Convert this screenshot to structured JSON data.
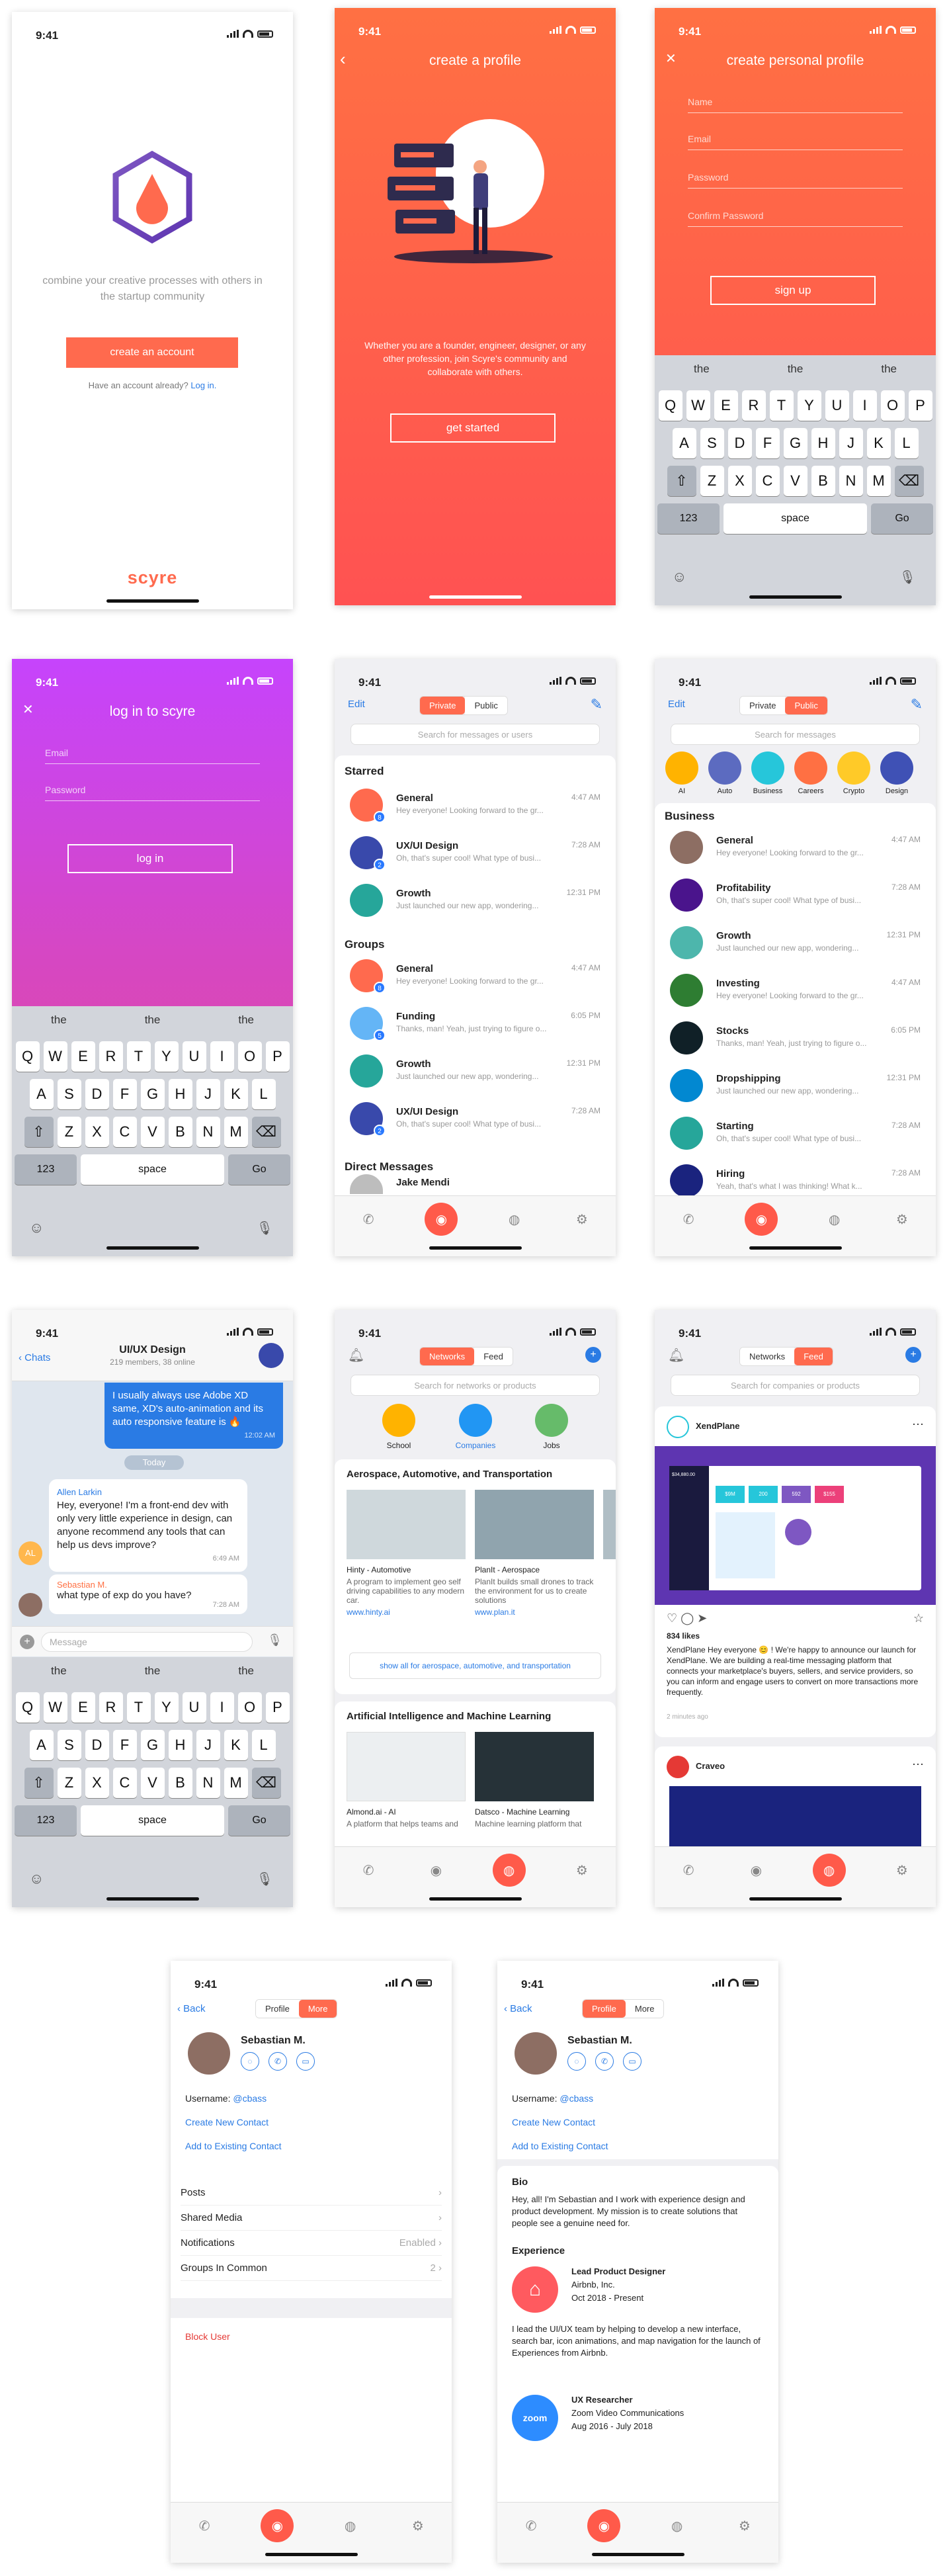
{
  "time": "9:41",
  "s1": {
    "tagline": "combine your creative processes with others in the startup community",
    "create_btn": "create an account",
    "have_account": "Have an account already?",
    "login_link": "Log in.",
    "brand": "scyre"
  },
  "s2": {
    "title": "create a profile",
    "desc": "Whether you are a founder, engineer, designer, or any other profession, join Scyre's community and collaborate with others.",
    "btn": "get started"
  },
  "s3": {
    "title": "create personal profile",
    "fields": [
      "Name",
      "Email",
      "Password",
      "Confirm Password"
    ],
    "btn": "sign up"
  },
  "s4": {
    "title": "log in to scyre",
    "fields": [
      "Email",
      "Password"
    ],
    "btn": "log in"
  },
  "kb": {
    "sugg": [
      "the",
      "the",
      "the"
    ],
    "r1": [
      "Q",
      "W",
      "E",
      "R",
      "T",
      "Y",
      "U",
      "I",
      "O",
      "P"
    ],
    "r2": [
      "A",
      "S",
      "D",
      "F",
      "G",
      "H",
      "J",
      "K",
      "L"
    ],
    "r3": [
      "Z",
      "X",
      "C",
      "V",
      "B",
      "N",
      "M"
    ],
    "num": "123",
    "space": "space",
    "go": "Go"
  },
  "s5": {
    "edit": "Edit",
    "tabs": [
      "Private",
      "Public"
    ],
    "search": "Search for messages or users",
    "starred": "Starred",
    "groups": "Groups",
    "direct": "Direct Messages",
    "starred_chats": [
      {
        "name": "General",
        "time": "4:47 AM",
        "preview": "Hey everyone! Looking forward to the gr...",
        "badge": "8",
        "color": "#ff6a4e"
      },
      {
        "name": "UX/UI Design",
        "time": "7:28 AM",
        "preview": "Oh, that's super cool! What type of busi...",
        "badge": "2",
        "color": "#3949ab"
      },
      {
        "name": "Growth",
        "time": "12:31 PM",
        "preview": "Just launched our new app, wondering...",
        "badge": "",
        "color": "#26a69a"
      }
    ],
    "group_chats": [
      {
        "name": "General",
        "time": "4:47 AM",
        "preview": "Hey everyone! Looking forward to the gr...",
        "badge": "8",
        "color": "#ff6a4e"
      },
      {
        "name": "Funding",
        "time": "6:05 PM",
        "preview": "Thanks, man! Yeah, just trying to figure o...",
        "badge": "5",
        "color": "#64b5f6"
      },
      {
        "name": "Growth",
        "time": "12:31 PM",
        "preview": "Just launched our new app, wondering...",
        "badge": "",
        "color": "#26a69a"
      },
      {
        "name": "UX/UI Design",
        "time": "7:28 AM",
        "preview": "Oh, that's super cool! What type of busi...",
        "badge": "2",
        "color": "#3949ab"
      }
    ],
    "dm": "Jake Mendi"
  },
  "s6": {
    "edit": "Edit",
    "tabs": [
      "Private",
      "Public"
    ],
    "search": "Search for messages",
    "cats": [
      {
        "label": "AI",
        "color": "#ffb300"
      },
      {
        "label": "Auto",
        "color": "#5c6bc0"
      },
      {
        "label": "Business",
        "color": "#26c6da"
      },
      {
        "label": "Careers",
        "color": "#ff7043"
      },
      {
        "label": "Crypto",
        "color": "#ffca28"
      },
      {
        "label": "Design",
        "color": "#3f51b5"
      }
    ],
    "section": "Business",
    "chats": [
      {
        "name": "General",
        "time": "4:47 AM",
        "preview": "Hey everyone! Looking forward to the gr...",
        "color": "#8d6e63"
      },
      {
        "name": "Profitability",
        "time": "7:28 AM",
        "preview": "Oh, that's super cool! What type of busi...",
        "color": "#4a148c"
      },
      {
        "name": "Growth",
        "time": "12:31 PM",
        "preview": "Just launched our new app, wondering...",
        "color": "#4db6ac"
      },
      {
        "name": "Investing",
        "time": "4:47 AM",
        "preview": "Hey everyone! Looking forward to the gr...",
        "color": "#2e7d32"
      },
      {
        "name": "Stocks",
        "time": "6:05 PM",
        "preview": "Thanks, man! Yeah, just trying to figure o...",
        "color": "#102027"
      },
      {
        "name": "Dropshipping",
        "time": "12:31 PM",
        "preview": "Just launched our new app, wondering...",
        "color": "#0288d1"
      },
      {
        "name": "Starting",
        "time": "7:28 AM",
        "preview": "Oh, that's super cool! What type of busi...",
        "color": "#26a69a"
      },
      {
        "name": "Hiring",
        "time": "7:28 AM",
        "preview": "Yeah, that's what I was thinking! What k...",
        "color": "#1a237e"
      }
    ]
  },
  "s7": {
    "back": "Chats",
    "title": "UI/UX Design",
    "sub": "219 members, 38 online",
    "msg1": "I usually always use Adobe XD same, XD's auto-animation and its auto responsive feature is 🔥",
    "msg1_time": "12:02 AM",
    "today": "Today",
    "sender1": "Allen Larkin",
    "msg2": "Hey, everyone! I'm a front-end dev with only very little experience in design, can anyone recommend any tools that can help us devs improve?",
    "msg2_time": "6:49 AM",
    "av1": "AL",
    "sender2": "Sebastian M.",
    "msg3": "what type of exp do you have?",
    "msg3_time": "7:28 AM",
    "placeholder": "Message"
  },
  "s8": {
    "tabs": [
      "Networks",
      "Feed"
    ],
    "search": "Search for networks or products",
    "cats": [
      "School",
      "Companies",
      "Jobs"
    ],
    "sec1": "Aerospace, Automotive, and Transportation",
    "cards1": [
      {
        "name": "Hinty - Automotive",
        "desc": "A program to implement geo self driving capabilities to any modern car.",
        "url": "www.hinty.ai"
      },
      {
        "name": "PlanIt - Aerospace",
        "desc": "PlanIt builds small drones to track the environment for us to create solutions",
        "url": "www.plan.it"
      }
    ],
    "showall": "show all for aerospace, automotive, and transportation",
    "sec2": "Artificial Intelligence and Machine Learning",
    "cards2": [
      {
        "name": "Almond.ai - AI",
        "desc": "A platform that helps teams and"
      },
      {
        "name": "Datsco - Machine Learning",
        "desc": "Machine learning platform that"
      }
    ]
  },
  "s9": {
    "tabs": [
      "Networks",
      "Feed"
    ],
    "search": "Search for companies or products",
    "post1": "XendPlane",
    "likes": "834 likes",
    "caption": "XendPlane Hey everyone 😊 ! We're happy to announce our launch for XendPlane. We are building a real-time messaging platform that connects your marketplace's buyers, sellers, and service providers, so you can inform and engage users to convert on more transactions more frequently.",
    "ago": "2 minutes ago",
    "post2": "Craveo",
    "stats": [
      "$34,880.00",
      "$9M",
      "200",
      "592",
      "$155"
    ]
  },
  "s10": {
    "back": "Back",
    "tabs": [
      "Profile",
      "More"
    ],
    "name": "Sebastian M.",
    "user_label": "Username:",
    "user": "@cbass",
    "create": "Create New Contact",
    "add": "Add to Existing Contact",
    "rows": [
      {
        "label": "Posts",
        "val": ""
      },
      {
        "label": "Shared Media",
        "val": ""
      },
      {
        "label": "Notifications",
        "val": "Enabled"
      },
      {
        "label": "Groups In Common",
        "val": "2"
      }
    ],
    "block": "Block User"
  },
  "s11": {
    "back": "Back",
    "tabs": [
      "Profile",
      "More"
    ],
    "name": "Sebastian M.",
    "user_label": "Username:",
    "user": "@cbass",
    "create": "Create New Contact",
    "add": "Add to Existing Contact",
    "bio_t": "Bio",
    "bio": "Hey, all! I'm Sebastian and I work with experience design and product development. My mission is to create solutions that people see a genuine need for.",
    "exp_t": "Experience",
    "j1_title": "Lead Product Designer",
    "j1_co": "Airbnb, Inc.",
    "j1_date": "Oct 2018 - Present",
    "j1_desc": "I lead the UI/UX team by helping to develop a new interface, search bar, icon animations, and map navigation for the launch of Experiences from Airbnb.",
    "j2_title": "UX Researcher",
    "j2_co": "Zoom Video Communications",
    "j2_date": "Aug 2016 - July 2018",
    "zoom": "zoom"
  },
  "colors": {
    "accent": "#ff6a4e",
    "blue": "#2a7be4",
    "purple": "#c644fc"
  }
}
